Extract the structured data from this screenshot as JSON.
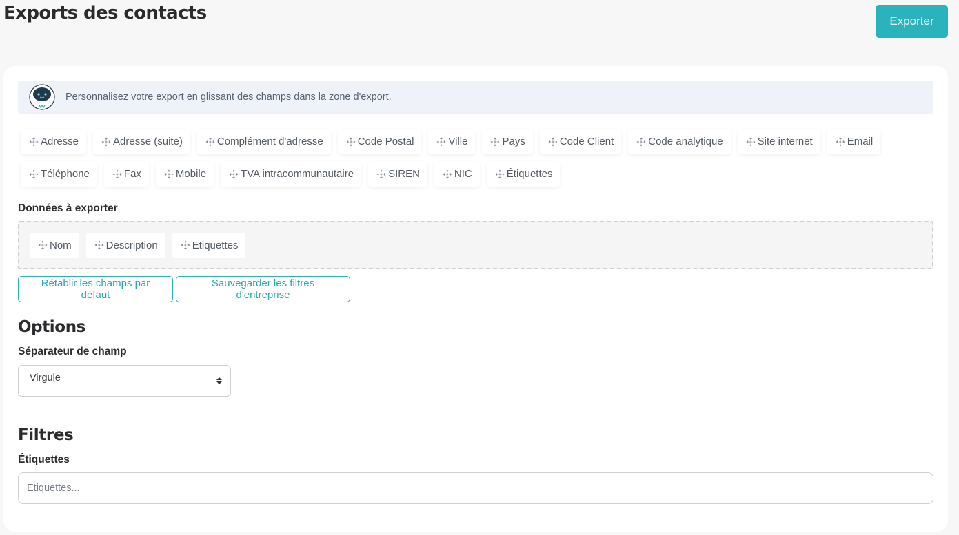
{
  "header": {
    "title": "Exports des contacts",
    "export_button": "Exporter"
  },
  "colors": {
    "accent": "#2ab3bd",
    "banner_bg": "#eff3f9",
    "drop_zone_bg": "#f5f5f5"
  },
  "info_banner": {
    "icon": "robot-assistant-icon",
    "text": "Personnalisez votre export en glissant des champs dans la zone d'export."
  },
  "available_fields": {
    "row1": [
      {
        "label": "Adresse",
        "icon": "move-icon"
      },
      {
        "label": "Adresse (suite)",
        "icon": "move-icon"
      },
      {
        "label": "Complément d'adresse",
        "icon": "move-icon"
      },
      {
        "label": "Code Postal",
        "icon": "move-icon"
      },
      {
        "label": "Ville",
        "icon": "move-icon"
      },
      {
        "label": "Pays",
        "icon": "move-icon"
      },
      {
        "label": "Code Client",
        "icon": "move-icon"
      },
      {
        "label": "Code analytique",
        "icon": "move-icon"
      },
      {
        "label": "Site internet",
        "icon": "move-icon"
      },
      {
        "label": "Email",
        "icon": "move-icon"
      }
    ],
    "row2": [
      {
        "label": "Téléphone",
        "icon": "move-icon"
      },
      {
        "label": "Fax",
        "icon": "move-icon"
      },
      {
        "label": "Mobile",
        "icon": "move-icon"
      },
      {
        "label": "TVA intracommunautaire",
        "icon": "move-icon"
      },
      {
        "label": "SIREN",
        "icon": "move-icon"
      },
      {
        "label": "NIC",
        "icon": "move-icon"
      },
      {
        "label": "Étiquettes",
        "icon": "move-icon"
      }
    ]
  },
  "export_zone": {
    "label": "Données à exporter",
    "fields": [
      {
        "label": "Nom",
        "icon": "move-icon"
      },
      {
        "label": "Description",
        "icon": "move-icon"
      },
      {
        "label": "Etiquettes",
        "icon": "move-icon"
      }
    ]
  },
  "actions": {
    "reset_defaults": "Rétablir les champs par défaut",
    "save_filters": "Sauvegarder les filtres d'entreprise"
  },
  "options": {
    "heading": "Options",
    "separator_label": "Séparateur de champ",
    "separator_value": "Virgule"
  },
  "filters": {
    "heading": "Filtres",
    "tags_label": "Étiquettes",
    "tags_placeholder": "Étiquettes...",
    "tags_value": ""
  }
}
